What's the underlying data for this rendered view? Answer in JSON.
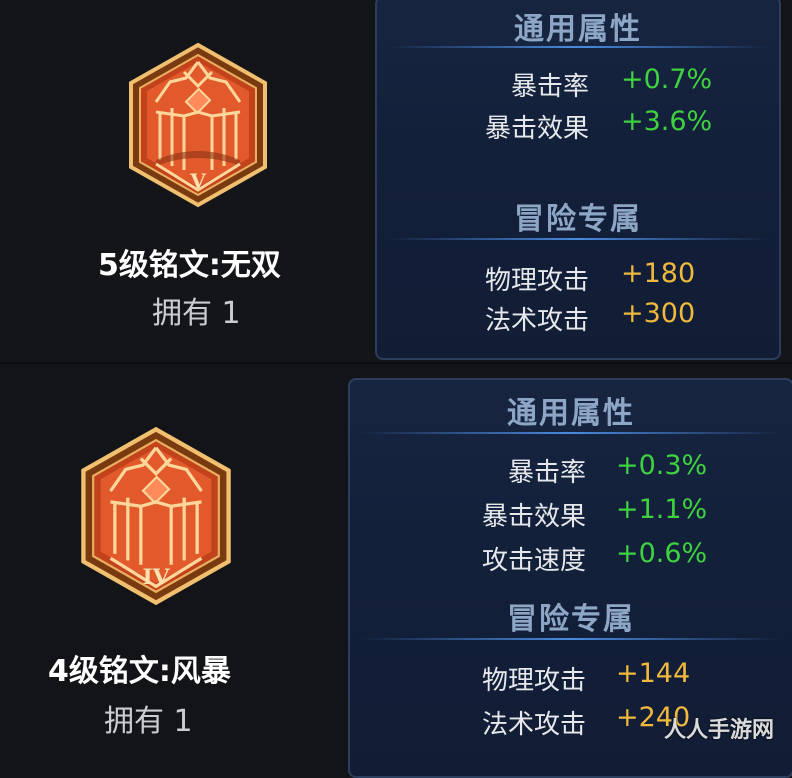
{
  "runes": [
    {
      "numeral": "V",
      "name": "5级铭文:无双",
      "owned": "拥有 1",
      "general_title": "通用属性",
      "general_stats": [
        {
          "label": "暴击率",
          "value": "+0.7%"
        },
        {
          "label": "暴击效果",
          "value": "+3.6%"
        }
      ],
      "adventure_title": "冒险专属",
      "adventure_stats": [
        {
          "label": "物理攻击",
          "value": "+180"
        },
        {
          "label": "法术攻击",
          "value": "+300"
        }
      ]
    },
    {
      "numeral": "IV",
      "name": "4级铭文:风暴",
      "owned": "拥有 1",
      "general_title": "通用属性",
      "general_stats": [
        {
          "label": "暴击率",
          "value": "+0.3%"
        },
        {
          "label": "暴击效果",
          "value": "+1.1%"
        },
        {
          "label": "攻击速度",
          "value": "+0.6%"
        }
      ],
      "adventure_title": "冒险专属",
      "adventure_stats": [
        {
          "label": "物理攻击",
          "value": "+144"
        },
        {
          "label": "法术攻击",
          "value": "+240"
        }
      ]
    }
  ],
  "watermark": "人人手游网",
  "colors": {
    "green_stat": "#3fd23f",
    "gold_stat": "#f0b83c",
    "section_title": "#8ea6c6",
    "emblem_red": "#e0542a",
    "emblem_gold": "#e9b15c"
  }
}
